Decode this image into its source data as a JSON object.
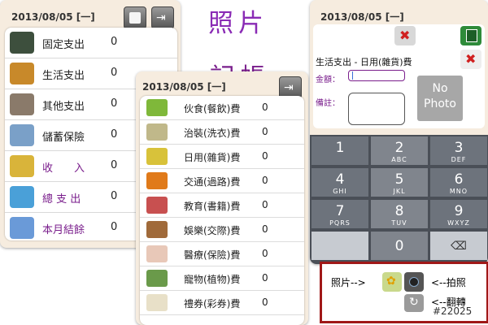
{
  "overlay": {
    "title_top": "照片",
    "title_bottom": "記帳"
  },
  "screen1": {
    "date": "2013/08/05 [一]",
    "items": [
      {
        "label": "固定支出",
        "value": "0",
        "icon": "wallet-icon",
        "style": "normal"
      },
      {
        "label": "生活支出",
        "value": "0",
        "icon": "shopping-cart-icon",
        "style": "normal"
      },
      {
        "label": "其他支出",
        "value": "0",
        "icon": "cash-register-icon",
        "style": "normal"
      },
      {
        "label": "儲蓄保險",
        "value": "0",
        "icon": "bank-icon",
        "style": "normal"
      },
      {
        "label": "收　　入",
        "value": "0",
        "icon": "coins-icon",
        "style": "purple"
      },
      {
        "label": "總 支 出",
        "value": "0",
        "icon": "pencil-icon",
        "style": "purple"
      },
      {
        "label": "本月結餘",
        "value": "0",
        "icon": "calculator-icon",
        "style": "purple"
      }
    ]
  },
  "screen2": {
    "date": "2013/08/05 [一]",
    "items": [
      {
        "label": "伙食(餐飲)費",
        "value": "0",
        "icon": "food-icon"
      },
      {
        "label": "治裝(洗衣)費",
        "value": "0",
        "icon": "clothes-icon"
      },
      {
        "label": "日用(雜貨)費",
        "value": "0",
        "icon": "groceries-icon"
      },
      {
        "label": "交通(過路)費",
        "value": "0",
        "icon": "truck-icon"
      },
      {
        "label": "教育(書籍)費",
        "value": "0",
        "icon": "books-icon"
      },
      {
        "label": "娛樂(交際)費",
        "value": "0",
        "icon": "party-icon"
      },
      {
        "label": "醫療(保險)費",
        "value": "0",
        "icon": "medical-icon"
      },
      {
        "label": "寵物(植物)費",
        "value": "0",
        "icon": "plant-icon"
      },
      {
        "label": "禮券(彩券)費",
        "value": "0",
        "icon": "ticket-icon"
      }
    ]
  },
  "screen3": {
    "date": "2013/08/05 [一]",
    "category": "生活支出 - 日用(雜貨)費",
    "amount_label": "金額：",
    "note_label": "備註：",
    "no_photo_line1": "No",
    "no_photo_line2": "Photo",
    "keys": [
      {
        "n": "1",
        "l": ""
      },
      {
        "n": "2",
        "l": "ABC"
      },
      {
        "n": "3",
        "l": "DEF"
      },
      {
        "n": "4",
        "l": "GHI"
      },
      {
        "n": "5",
        "l": "JKL"
      },
      {
        "n": "6",
        "l": "MNO"
      },
      {
        "n": "7",
        "l": "PQRS"
      },
      {
        "n": "8",
        "l": "TUV"
      },
      {
        "n": "9",
        "l": "WXYZ"
      },
      {
        "n": "",
        "l": ""
      },
      {
        "n": "0",
        "l": ""
      },
      {
        "n": "⌫",
        "l": ""
      }
    ]
  },
  "legend": {
    "photo_label": "照片-->",
    "take_photo": "<--拍照",
    "rotate": "<--翻轉",
    "tag": "#22025"
  },
  "colors": {
    "accent_purple": "#7a1e8c",
    "legend_border": "#a01818"
  }
}
